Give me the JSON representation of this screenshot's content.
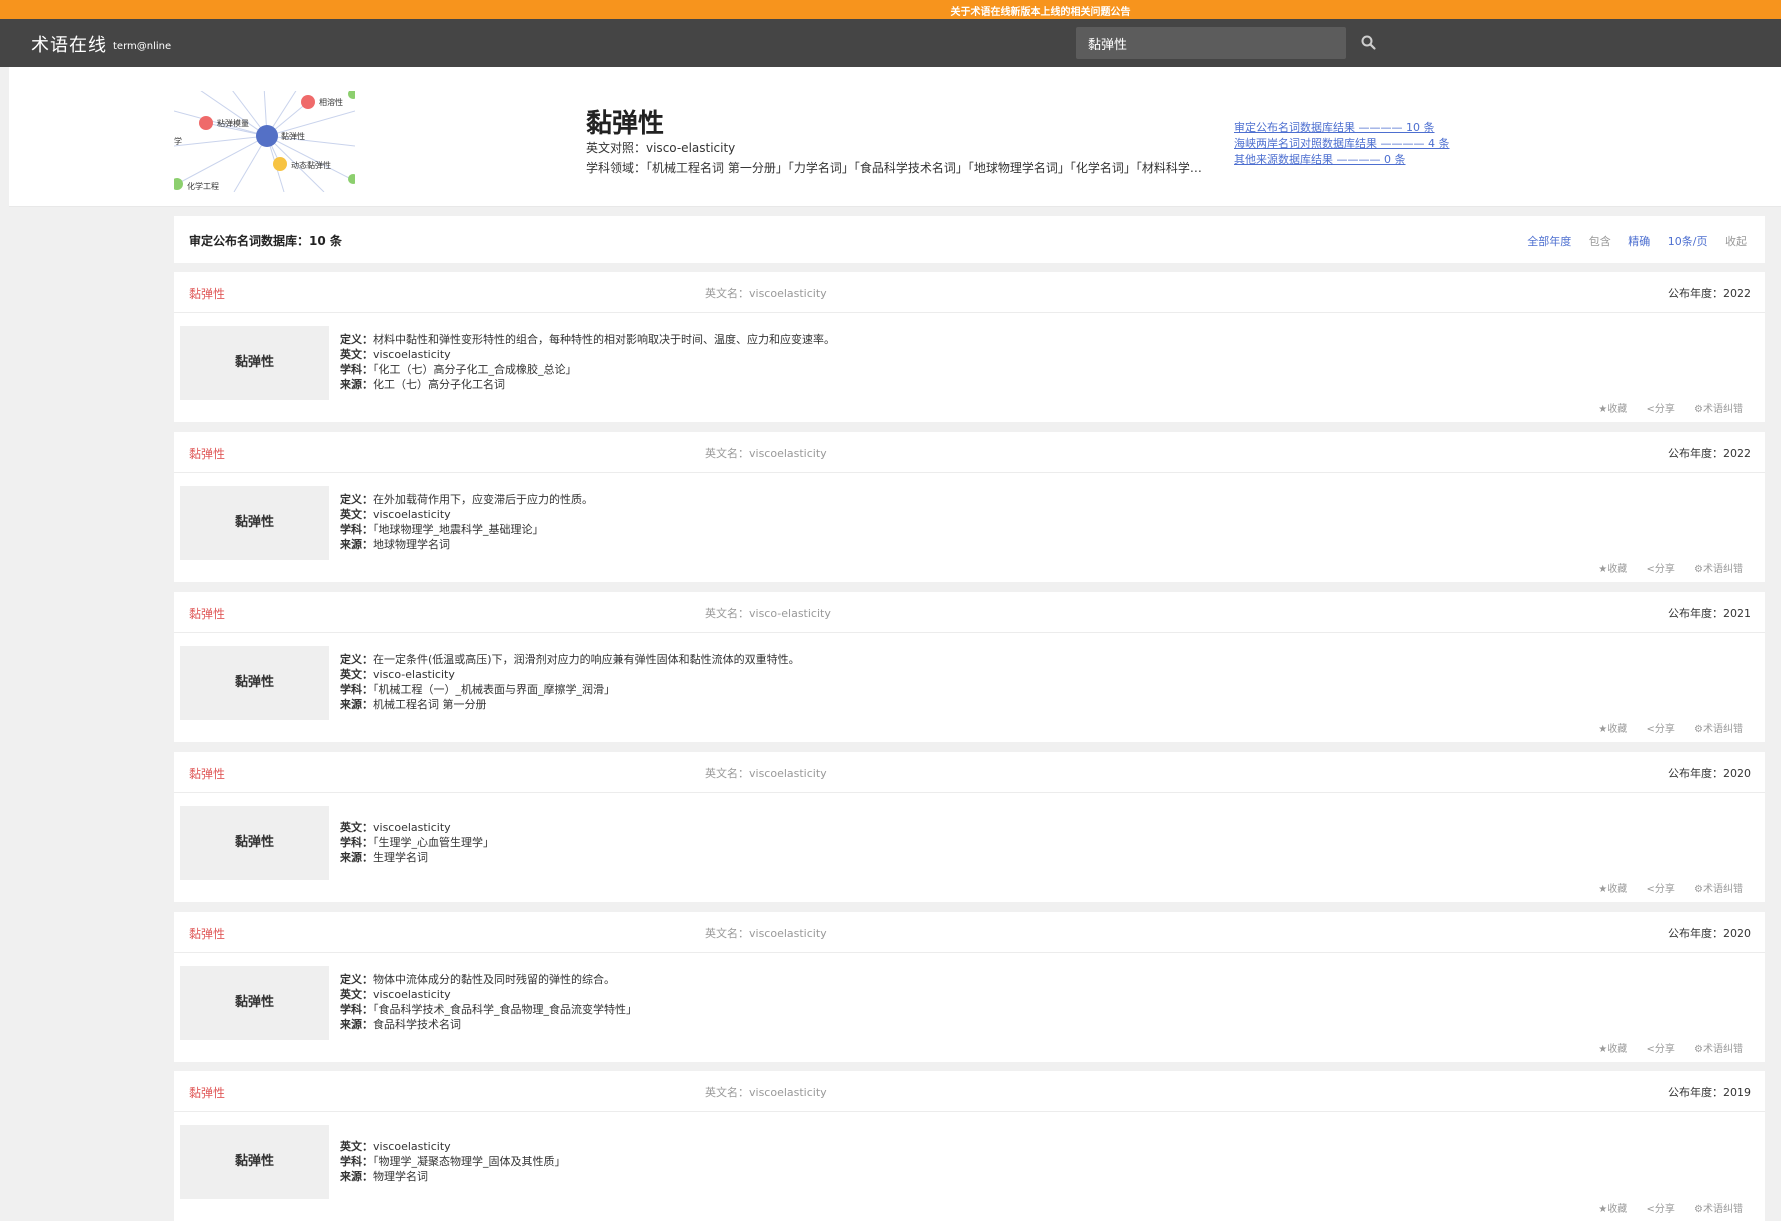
{
  "notice": {
    "text": "关于术语在线新版本上线的相关问题公告"
  },
  "header": {
    "logo_cn": "术语在线",
    "logo_en": "term@nline",
    "search_value": "黏弹性"
  },
  "graph": {
    "nodes": [
      "相溶性",
      "粘弹模量",
      "黏弹性",
      "动态黏弹性",
      "化学工程",
      "学"
    ]
  },
  "term": {
    "title": "黏弹性",
    "en": "英文对照：visco-elasticity",
    "field": "学科领域：「机械工程名词 第一分册」「力学名词」「食品科学技术名词」「地球物理学名词」「化学名词」「材料科学技术名词」"
  },
  "db_links": [
    "审定公布名词数据库结果 ———— 10 条",
    "海峡两岸名词对照数据库结果 ———— 4 条",
    "其他来源数据库结果 ———— 0 条"
  ],
  "summary": {
    "title": "审定公布名词数据库：10 条",
    "controls": [
      "全部年度",
      "包含",
      "精确",
      "10条/页",
      "收起"
    ]
  },
  "colors": {
    "notice_bar": "#f7941d",
    "header_bg": "#454545",
    "term_red": "#e05a5a",
    "link_blue": "#4d6fd0"
  },
  "labels": {
    "en_name": "英文名：",
    "year": "公布年度：",
    "def": "定义：",
    "en": "英文：",
    "subject": "学科：",
    "source": "来源："
  },
  "actions": [
    "★收藏",
    "<分享",
    "⚙术语纠错"
  ],
  "cards": [
    {
      "term": "黏弹性",
      "en_name": "viscoelasticity",
      "year": "2022",
      "definition": "材料中黏性和弹性变形特性的组合，每种特性的相对影响取决于时间、温度、应力和应变速率。",
      "english": "viscoelasticity",
      "subject": "「化工（七）高分子化工_合成橡胶_总论」",
      "source": "化工（七）高分子化工名词"
    },
    {
      "term": "黏弹性",
      "en_name": "viscoelasticity",
      "year": "2022",
      "definition": "在外加载荷作用下，应变滞后于应力的性质。",
      "english": "viscoelasticity",
      "subject": "「地球物理学_地震科学_基础理论」",
      "source": "地球物理学名词"
    },
    {
      "term": "黏弹性",
      "en_name": "visco-elasticity",
      "year": "2021",
      "definition": "在一定条件(低温或高压)下，润滑剂对应力的响应兼有弹性固体和黏性流体的双重特性。",
      "english": "visco-elasticity",
      "subject": "「机械工程（一）_机械表面与界面_摩擦学_润滑」",
      "source": "机械工程名词 第一分册"
    },
    {
      "term": "黏弹性",
      "en_name": "viscoelasticity",
      "year": "2020",
      "definition": "",
      "english": "viscoelasticity",
      "subject": "「生理学_心血管生理学」",
      "source": "生理学名词"
    },
    {
      "term": "黏弹性",
      "en_name": "viscoelasticity",
      "year": "2020",
      "definition": "物体中流体成分的黏性及同时残留的弹性的综合。",
      "english": "viscoelasticity",
      "subject": "「食品科学技术_食品科学_食品物理_食品流变学特性」",
      "source": "食品科学技术名词"
    },
    {
      "term": "黏弹性",
      "en_name": "viscoelasticity",
      "year": "2019",
      "definition": "",
      "english": "viscoelasticity",
      "subject": "「物理学_凝聚态物理学_固体及其性质」",
      "source": "物理学名词"
    }
  ]
}
